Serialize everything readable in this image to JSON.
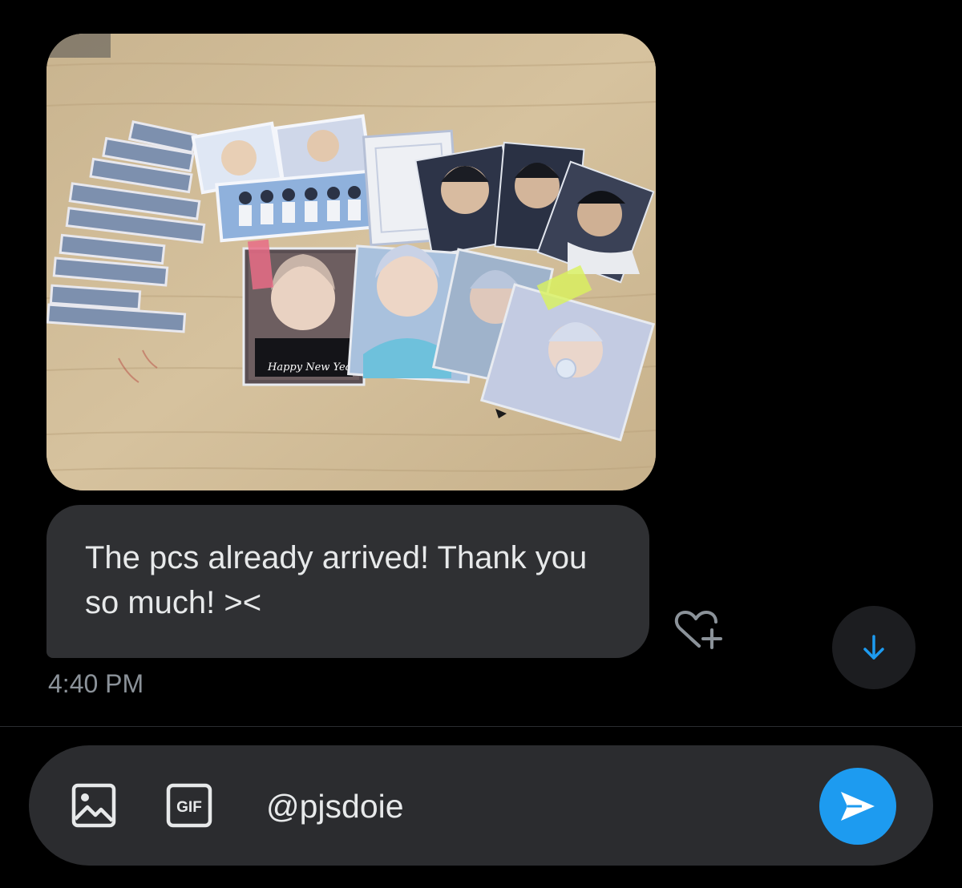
{
  "conversation": {
    "photo_message": {
      "card_caption": "Happy New Year !"
    },
    "text_message": "The pcs already arrived! Thank you so much! ><",
    "timestamp": "4:40 PM",
    "react_icon": "heart-plus-icon",
    "scroll_icon": "arrow-down-icon"
  },
  "composer": {
    "input_value": "@pjsdoie",
    "media_icon": "image-icon",
    "gif_label": "GIF",
    "send_icon": "send-icon"
  },
  "colors": {
    "background": "#000000",
    "bubble": "#2f3033",
    "composer": "#2b2c2f",
    "accent": "#1d9bf0",
    "timestamp": "#8b9299",
    "text": "#e7e9ea"
  }
}
